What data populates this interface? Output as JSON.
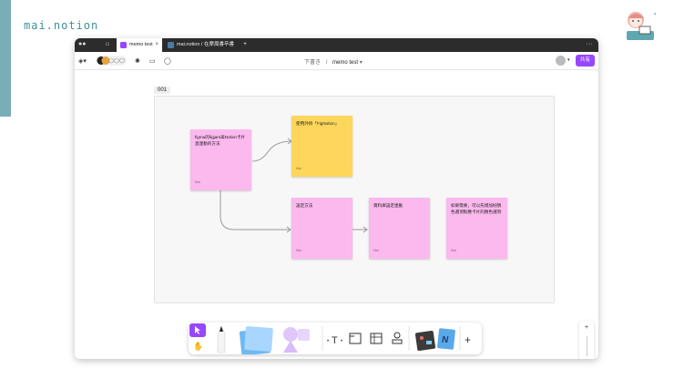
{
  "brand": "mai.notion",
  "browser": {
    "tabs": [
      {
        "label": "memo test"
      },
      {
        "label": "mai.notion / 在摩周書卒書"
      }
    ]
  },
  "toolbar": {
    "breadcrumb_draft": "下書き",
    "breadcrumb_sep": "/",
    "file_name": "memo test",
    "share_label": "共有"
  },
  "canvas": {
    "frame_label": "001",
    "stickies": [
      {
        "text": "figma的figjam與Notion卡片直連動的方法",
        "author": "Mai",
        "color": "pink"
      },
      {
        "text": "使用外掛「FigNotion」",
        "author": "Mai",
        "color": "yellow"
      },
      {
        "text": "設定方法",
        "author": "Mai",
        "color": "pink"
      },
      {
        "text": "資料庫設定連動",
        "author": "Mai",
        "color": "pink"
      },
      {
        "text": "如果需要，可以先增加好顏色選項對應卡片的顏色選項",
        "author": "Mai",
        "color": "pink"
      }
    ]
  },
  "dock": {
    "text_tool_label": "T"
  },
  "zoom": {
    "plus": "+",
    "minus": "−"
  },
  "help": {
    "label": "?"
  },
  "colors": {
    "accent": "#9747ff",
    "sticky_pink": "#fbb9ee",
    "sticky_yellow": "#fdd65b",
    "brand": "#3f8f9c"
  }
}
